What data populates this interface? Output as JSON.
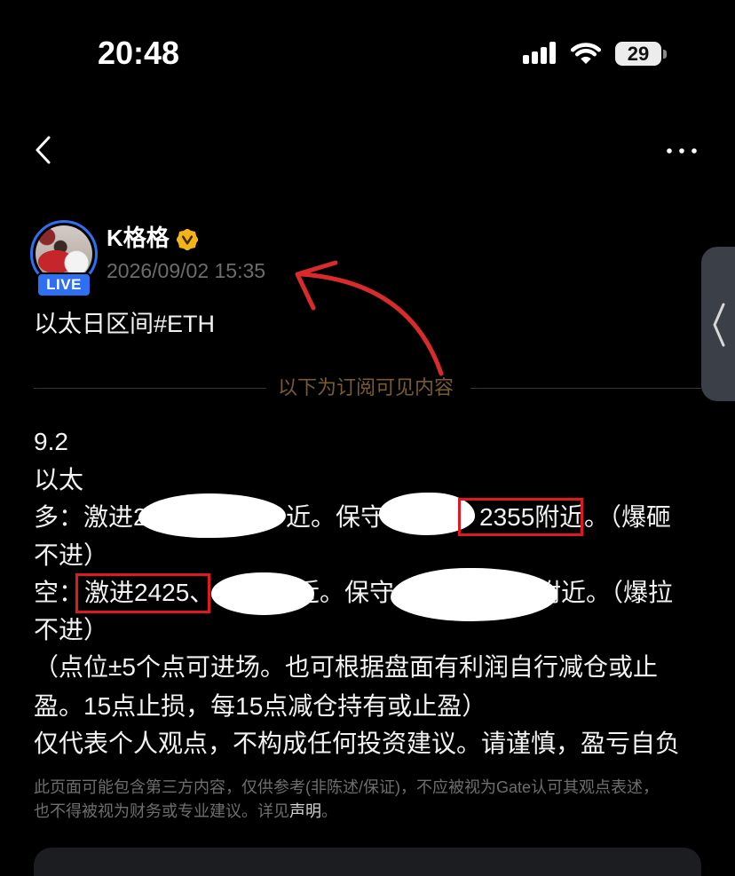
{
  "status_bar": {
    "time": "20:48",
    "battery_level": "29",
    "signal_icon": "cellular-signal-icon",
    "wifi_icon": "wifi-icon",
    "battery_icon": "battery-icon"
  },
  "nav": {
    "back_icon": "chevron-left-icon",
    "more_icon": "more-horizontal-icon"
  },
  "author": {
    "name": "K格格",
    "live_badge": "LIVE",
    "timestamp": "2026/09/02 15:35",
    "verified_icon": "verified-badge-icon"
  },
  "post": {
    "title": "以太日区间#ETH",
    "paywall_divider": "以下为订阅可见内容",
    "body": {
      "date": "9.2",
      "asset": "以太",
      "long_line": {
        "lead": "多：激进2",
        "middle": "近。保守",
        "highlighted": "2355附近",
        "tail": "。（爆砸"
      },
      "long_line_cont": "不进）",
      "short_line": {
        "lead": "空：",
        "highlighted": "激进2425、",
        "middle": "近。保守",
        "tail": "附近。（爆拉"
      },
      "short_line_cont": "不进）",
      "note_line_1": "（点位±5个点可进场。也可根据盘面有利润自行减仓或止",
      "note_line_2": "盈。15点止损，每15点减仓持有或止盈）",
      "note_line_3": "仅代表个人观点，不构成任何投资建议。请谨慎，盈亏自负"
    }
  },
  "disclaimer": {
    "line_1": "此页面可能包含第三方内容，仅供参考(非陈述/保证)，不应被视为Gate认可其观点表述，",
    "line_2": "也不得被视为财务或专业建议。详见",
    "link": "声明",
    "line_2_end": "。"
  },
  "side_tab": {
    "icon": "chevron-left-icon"
  },
  "colors": {
    "background": "#000000",
    "text_primary": "#f2f2f2",
    "text_secondary": "#6c6c6c",
    "accent_blue": "#2f6ff2",
    "verified_gold": "#f2b419",
    "divider_label": "#7a5b30",
    "annotation_red": "#e0181f",
    "side_tab": "#3b3f48"
  }
}
